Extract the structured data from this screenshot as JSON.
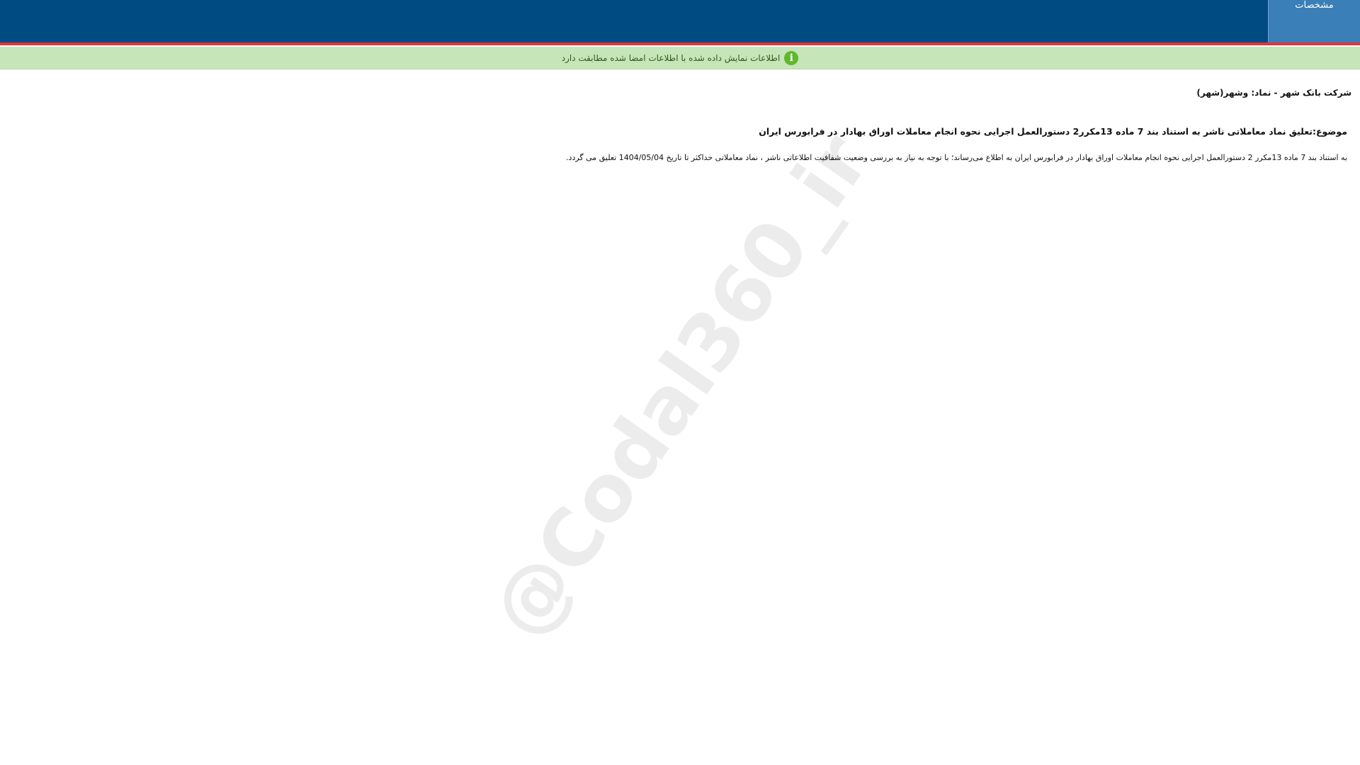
{
  "header": {
    "tab_label": "مشخصات"
  },
  "notice": {
    "icon": "info-icon",
    "text": "اطلاعات نمایش داده شده با اطلاعات امضا شده مطابقت دارد"
  },
  "content": {
    "company_line": "شرکت بانک شهر - نماد: وشهر(شهر)",
    "subject": "موضوع:تعلیق نماد معاملاتی ناشر به استناد بند 7 ماده 13مکرر2 دستورالعمل اجرایی نحوه انجام معاملات اوراق بهادار در فرابورس ایران",
    "body": "به استناد بند 7 ماده 13مکرر 2 دستورالعمل اجرایی نحوه انجام معاملات اوراق بهادار در فرابورس ایران به اطلاع می‌رساند؛ با توجه به نیاز به بررسی وضعیت شفافیت اطلاعاتی ناشر ، نماد معاملاتی حداکثر تا تاریخ 1404/05/04 تعلیق می گردد."
  },
  "watermark": {
    "text": "@Codal360_ir"
  },
  "colors": {
    "header_bg": "#004b82",
    "header_accent": "#e5333b",
    "tab_bg": "#3a7fb7",
    "notice_bg": "#c6e5b8",
    "notice_icon": "#5fb82d"
  }
}
